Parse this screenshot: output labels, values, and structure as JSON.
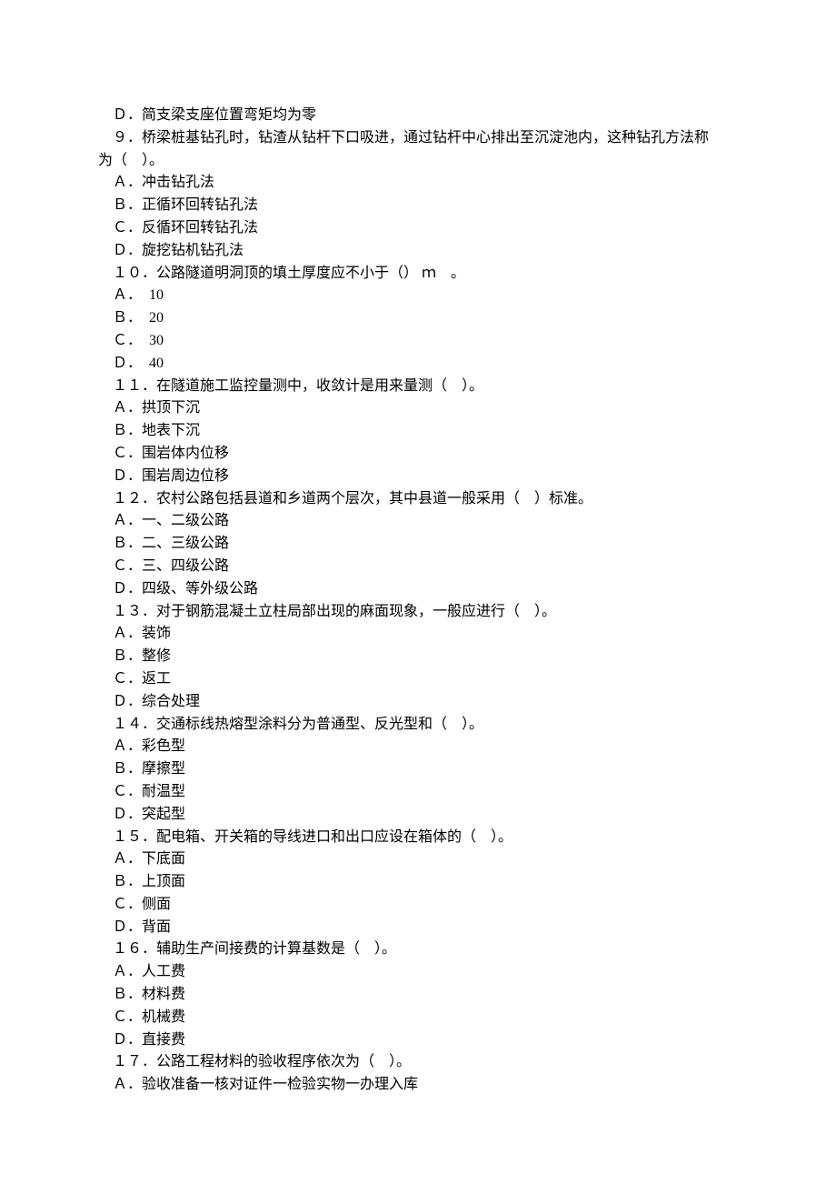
{
  "lines": [
    {
      "id": "l-d-prev",
      "text": "Ｄ．简支梁支座位置弯矩均为零"
    },
    {
      "id": "q9-stem1",
      "text": "９．桥梁桩基钻孔时，钻渣从钻杆下口吸进，通过钻杆中心排出至沉淀池内，这种钻孔方法称"
    },
    {
      "id": "q9-stem2",
      "text": "为（　）。",
      "outdent": true
    },
    {
      "id": "q9-a",
      "text": "Ａ．冲击钻孔法"
    },
    {
      "id": "q9-b",
      "text": "Ｂ．正循环回转钻孔法"
    },
    {
      "id": "q9-c",
      "text": "Ｃ．反循环回转钻孔法"
    },
    {
      "id": "q9-d",
      "text": "Ｄ．旋挖钻机钻孔法"
    },
    {
      "id": "q10-stem",
      "text": "１０．公路隧道明洞顶的填土厚度应不小于（） ｍ　。"
    },
    {
      "id": "q10-a",
      "text": "Ａ．　10"
    },
    {
      "id": "q10-b",
      "text": "Ｂ．　20"
    },
    {
      "id": "q10-c",
      "text": "Ｃ．　30"
    },
    {
      "id": "q10-d",
      "text": "Ｄ．　40"
    },
    {
      "id": "q11-stem",
      "text": "１１．在隧道施工监控量测中，收敛计是用来量测（　）。"
    },
    {
      "id": "q11-a",
      "text": "Ａ．拱顶下沉"
    },
    {
      "id": "q11-b",
      "text": "Ｂ．地表下沉"
    },
    {
      "id": "q11-c",
      "text": "Ｃ．围岩体内位移"
    },
    {
      "id": "q11-d",
      "text": "Ｄ．围岩周边位移"
    },
    {
      "id": "q12-stem",
      "text": "１２．农村公路包括县道和乡道两个层次，其中县道一般采用（　）标准。"
    },
    {
      "id": "q12-a",
      "text": "Ａ．一、二级公路"
    },
    {
      "id": "q12-b",
      "text": "Ｂ．二、三级公路"
    },
    {
      "id": "q12-c",
      "text": "Ｃ．三、四级公路"
    },
    {
      "id": "q12-d",
      "text": "Ｄ．四级、等外级公路"
    },
    {
      "id": "q13-stem",
      "text": "１３．对于钢筋混凝土立柱局部出现的麻面现象，一般应进行（　）。"
    },
    {
      "id": "q13-a",
      "text": "Ａ．装饰"
    },
    {
      "id": "q13-b",
      "text": "Ｂ．整修"
    },
    {
      "id": "q13-c",
      "text": "Ｃ．返工"
    },
    {
      "id": "q13-d",
      "text": "Ｄ．综合处理"
    },
    {
      "id": "q14-stem",
      "text": "１４．交通标线热熔型涂料分为普通型、反光型和（　）。"
    },
    {
      "id": "q14-a",
      "text": "Ａ．彩色型"
    },
    {
      "id": "q14-b",
      "text": "Ｂ．摩擦型"
    },
    {
      "id": "q14-c",
      "text": "Ｃ．耐温型"
    },
    {
      "id": "q14-d",
      "text": "Ｄ．突起型"
    },
    {
      "id": "q15-stem",
      "text": "１５．配电箱、开关箱的导线进口和出口应设在箱体的（　）。"
    },
    {
      "id": "q15-a",
      "text": "Ａ．下底面"
    },
    {
      "id": "q15-b",
      "text": "Ｂ．上顶面"
    },
    {
      "id": "q15-c",
      "text": "Ｃ．侧面"
    },
    {
      "id": "q15-d",
      "text": "Ｄ．背面"
    },
    {
      "id": "q16-stem",
      "text": "１６．辅助生产间接费的计算基数是（　）。"
    },
    {
      "id": "q16-a",
      "text": "Ａ．人工费"
    },
    {
      "id": "q16-b",
      "text": "Ｂ．材料费"
    },
    {
      "id": "q16-c",
      "text": "Ｃ．机械费"
    },
    {
      "id": "q16-d",
      "text": "Ｄ．直接费"
    },
    {
      "id": "q17-stem",
      "text": "１７．公路工程材料的验收程序依次为（　）。"
    },
    {
      "id": "q17-a",
      "text": "Ａ．验收准备一核对证件一检验实物一办理入库"
    }
  ]
}
